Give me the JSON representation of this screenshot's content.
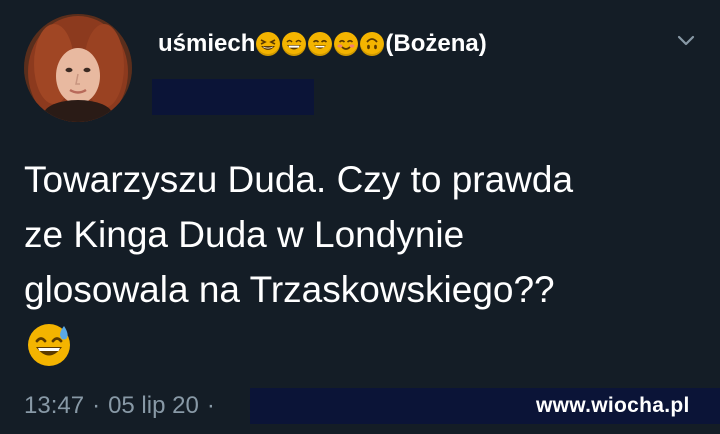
{
  "author": {
    "name_prefix": "uśmiech",
    "name_suffix": "(Bożena)",
    "emoji_icons": [
      "grinning-squinting-face-icon",
      "beaming-face-icon",
      "grinning-face-icon",
      "smiling-blushing-face-icon",
      "upside-down-face-icon"
    ]
  },
  "tweet": {
    "lines": [
      "Towarzyszu Duda. Czy to prawda",
      "ze Kinga Duda w Londynie",
      "glosowala na Trzaskowskiego??"
    ],
    "trailing_emoji": "grinning-face-with-sweat-icon"
  },
  "meta": {
    "time": "13:47",
    "separator": "·",
    "date": "05 lip 20",
    "separator2": "·"
  },
  "watermark": "www.wiocha.pl",
  "colors": {
    "background": "#141d26",
    "secondary_text": "#8899a6",
    "redaction": "#0b1437",
    "emoji_yellow": "#f4b400"
  }
}
